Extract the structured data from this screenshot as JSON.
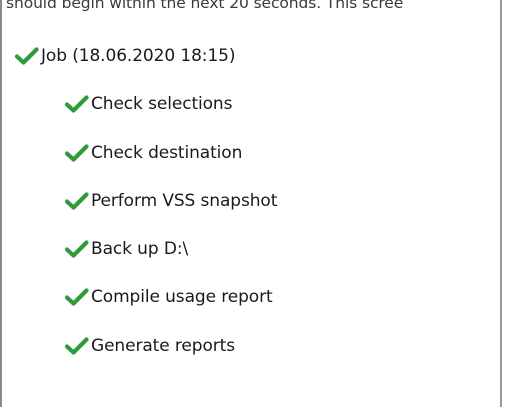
{
  "status_text": "should begin within the next 20 seconds. This scree",
  "job": {
    "label": "Job (18.06.2020 18:15)",
    "status_icon": "checkmark-icon",
    "steps": [
      {
        "label": "Check selections",
        "status_icon": "checkmark-icon"
      },
      {
        "label": "Check destination",
        "status_icon": "checkmark-icon"
      },
      {
        "label": "Perform VSS snapshot",
        "status_icon": "checkmark-icon"
      },
      {
        "label": "Back up D:\\",
        "status_icon": "checkmark-icon"
      },
      {
        "label": "Compile usage report",
        "status_icon": "checkmark-icon"
      },
      {
        "label": "Generate reports",
        "status_icon": "checkmark-icon"
      }
    ]
  },
  "colors": {
    "check_green": "#2e9b3a",
    "check_dark": "#1f7a2a",
    "text": "#1a1a1a"
  }
}
